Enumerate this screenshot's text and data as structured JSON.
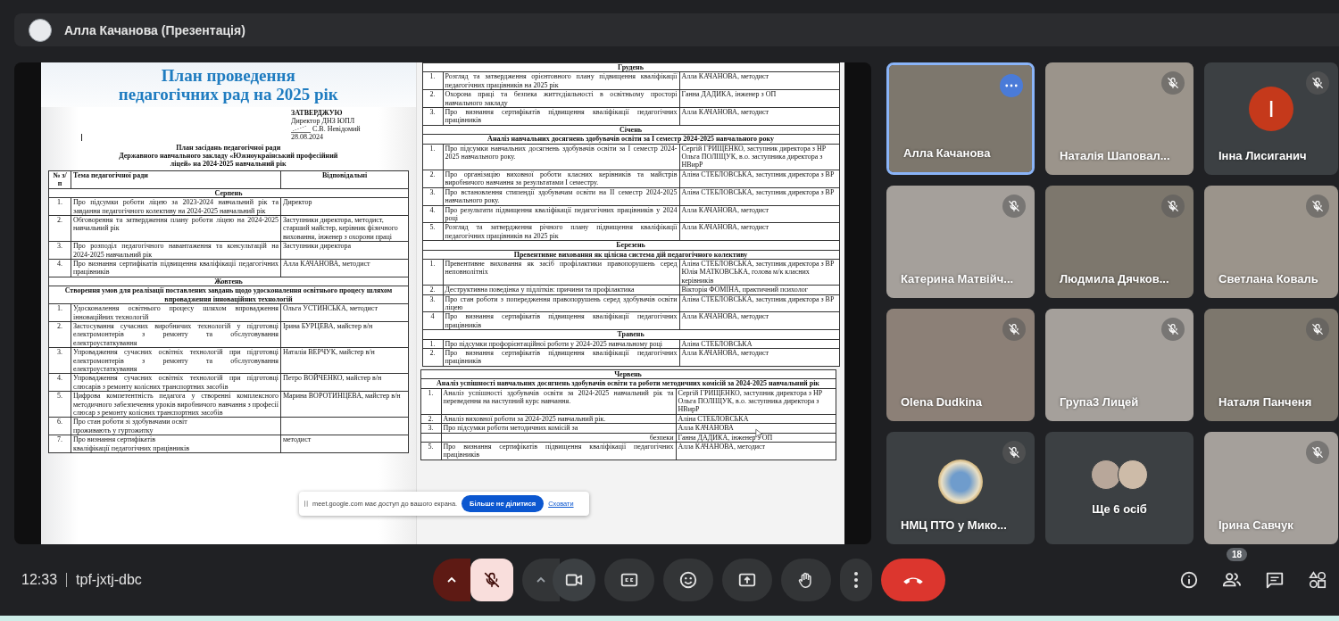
{
  "top_bar": {
    "title": "Алла Качанова (Презентація)"
  },
  "document": {
    "title_lines": [
      "План проведення",
      "педагогічних рад на 2025 рік"
    ],
    "approval": [
      {
        "text": "ЗАТВЕРДЖУЮ",
        "bold": true,
        "signed": false
      },
      {
        "text": "Директор ДНЗ ЮПЛ",
        "bold": false,
        "signed": false
      },
      {
        "text": "С.В. Невідомий",
        "bold": false,
        "signed": true
      },
      {
        "text": "28.08.2024",
        "bold": false,
        "signed": false
      }
    ],
    "heading_lines": [
      "План засідань педагогічної ради",
      "Державного навчального закладу «Южноукраїнський професійний",
      "ліцей» на 2024-2025 навчальний рік"
    ],
    "header": {
      "number": "№ з/п",
      "topic": "Тема педагогічної ради",
      "responsible": "Відповідальні"
    },
    "tables": [
      {
        "sections": [
          {
            "month": "Серпень",
            "rows": [
              {
                "number": "1.",
                "topic": "Про підсумки роботи ліцею за 2023-2024 навчальний рік та завдання педагогічного колективу на 2024-2025 навчальний рік",
                "responsible": "Директор"
              },
              {
                "number": "2.",
                "topic": "Обговорення та затвердження плану роботи ліцею на 2024-2025 навчальний рік",
                "responsible": "Заступники директора, методист, старший майстер, керівник фізичного виховання, інженер з охорони праці"
              },
              {
                "number": "3.",
                "topic": "Про розподіл педагогічного навантаження та консультацій на 2024-2025 навчальний рік",
                "responsible": "Заступники директора"
              },
              {
                "number": "4.",
                "topic": "Про визнання сертифікатів підвищення кваліфікації педагогічних працівників",
                "responsible": "Алла КАЧАНОВА, методист"
              }
            ]
          },
          {
            "month": "Жовтень",
            "theme": "Створення умов для реалізації поставлених завдань щодо удосконалення освітнього процесу шляхом впровадження інноваційних технологій",
            "rows": [
              {
                "number": "1.",
                "topic": "Удосконалення освітнього процесу шляхом впровадження інноваційних технологій",
                "responsible": "Ольга УСТИНСЬКА, методист"
              },
              {
                "number": "2.",
                "topic": "Застосування сучасних виробничих технологій у підготовці електромонтерів з ремонту та обслуговування електроустаткування",
                "responsible": "Ірина БУРЦЕВА, майстер в/н"
              },
              {
                "number": "3.",
                "topic": "Упровадження сучасних освітніх технологій при підготовці електромонтерів з ремонту та обслуговування електроустаткування",
                "responsible": "Наталія ВЕРЧУК, майстер в/н"
              },
              {
                "number": "4.",
                "topic": "Упровадження сучасних освітніх технологій при підготовці слюсарів з ремонту колісних транспортних засобів",
                "responsible": "Петро ВОЙЧЕНКО, майстер в/н"
              },
              {
                "number": "5.",
                "topic": "Цифрова компетентність педагога у створенні комплексного методичного забезпечення уроків виробничого навчання з професії слюсар з ремонту колісних транспортних засобів",
                "responsible": "Марина ВОРОТИНЦЕВА, майстер в/н"
              },
              {
                "number": "6.",
                "topic": "Про стан роботи зі здобувачами освіт\nпроживають у гуртожитку"
              },
              {
                "number": "7.",
                "topic": "Про визнання сертифікатів\nкваліфікації педагогічних працівників",
                "responsible": "методист"
              }
            ]
          }
        ]
      },
      {
        "sections": [
          {
            "month": "Грудень",
            "rows": [
              {
                "number": "1.",
                "topic": "Розгляд та затвердження орієнтовного плану підвищення кваліфікації педагогічних працівників на 2025 рік",
                "responsible": "Алла КАЧАНОВА, методист"
              },
              {
                "number": "2.",
                "topic": "Охорона праці та безпека життєдіяльності в освітньому просторі навчального закладу",
                "responsible": "Ганна ДАДИКА, інженер з ОП"
              },
              {
                "number": "3.",
                "topic": "Про визнання сертифікатів підвищення кваліфікації педагогічних працівників",
                "responsible": "Алла КАЧАНОВА, методист"
              }
            ]
          },
          {
            "month": "Січень",
            "theme": "Аналіз навчальних досягнень здобувачів освіти за I семестр 2024-2025 навчального року",
            "rows": [
              {
                "number": "1.",
                "topic": "Про підсумки навчальних досягнень здобувачів освіти за I семестр 2024-2025 навчального року.",
                "responsible": "Сергій ГРИЩЕНКО, заступник директора з НР Ольга ПОЛІЩУК, в.о. заступника директора з НВирР"
              },
              {
                "number": "2.",
                "topic": "Про організацію виховної роботи класних керівників та майстрів виробничого навчання за результатами I семестру.",
                "responsible": "Аліна СТЕБЛОВСЬКА, заступник директора з ВР"
              },
              {
                "number": "3.",
                "topic": "Про встановлення стипендії здобувачам освіти на II семестр 2024-2025 навчального року.",
                "responsible": "Аліна СТЕБЛОВСЬКА, заступник директора з ВР"
              },
              {
                "number": "4.",
                "topic": "Про результати підвищення кваліфікації педагогічних працівників у 2024 році",
                "responsible": "Алла КАЧАНОВА, методист"
              },
              {
                "number": "5.",
                "topic": "Розгляд та затвердження річного плану підвищення кваліфікації педагогічних працівників на 2025 рік",
                "responsible": "Алла КАЧАНОВА, методист"
              }
            ]
          },
          {
            "month": "Березень",
            "theme": "Превентивне виховання як цілісна система дій педагогічного колективу",
            "rows": [
              {
                "number": "1.",
                "topic": "Превентивне виховання як засіб профілактики правопорушень серед неповнолітніх",
                "responsible": "Аліна СТЕБЛОВСЬКА, заступник директора з ВР Юлія МАТКОВСЬКА, голова м/к класних керівників"
              },
              {
                "number": "2.",
                "topic": "Деструктивна поведінка у підлітків: причини та профілактика",
                "responsible": "Вікторія ФОМІНА, практичний психолог"
              },
              {
                "number": "3.",
                "topic": "Про стан роботи з попередження правопорушень серед здобувачів освіти ліцею",
                "responsible": "Аліна СТЕБЛОВСЬКА, заступник директора з ВР"
              },
              {
                "number": "4",
                "topic": "Про визнання сертифікатів підвищення кваліфікації педагогічних працівників",
                "responsible": "Алла КАЧАНОВА, методист"
              }
            ]
          },
          {
            "month": "Травень",
            "rows": [
              {
                "number": "1.",
                "topic": "Про підсумки профорієнтаційної роботи у 2024-2025 навчальному році",
                "responsible": "Аліна СТЕБЛОВСЬКА"
              },
              {
                "number": "2.",
                "topic": "Про визнання сертифікатів підвищення кваліфікації педагогічних працівників",
                "responsible": "Алла КАЧАНОВА, методист"
              }
            ]
          }
        ]
      },
      {
        "sections": [
          {
            "month": "Червень",
            "theme": "Аналіз успішності навчальних досягнень здобувачів освіти та роботи методичних комісій за 2024-2025 навчальний рік",
            "rows": [
              {
                "number": "1.",
                "topic": "Аналіз успішності здобувачів освіти за 2024-2025 навчальний рік та переведення на наступний курс навчання.",
                "responsible": "Сергій ГРИЩЕНКО, заступник директора з НР Ольга ПОЛІЩУК, в.о. заступника директора з НВирР"
              },
              {
                "number": "2.",
                "topic": "Аналіз виховної роботи за 2024-2025 навчальний рік.",
                "responsible": "Аліна СТЕБЛОВСЬКА"
              },
              {
                "number": "3.",
                "topic": "Про підсумки роботи методичних комісій за",
                "responsible": "Алла КАЧАНОВА"
              },
              {
                "topic": "безпеки",
                "responsible": "Ганна ДАДИКА, інженер з ОП"
              },
              {
                "number": "5.",
                "topic": "Про визнання сертифікатів підвищення кваліфікації педагогічних працівників",
                "responsible": "Алла КАЧАНОВА, методист"
              }
            ]
          }
        ]
      }
    ]
  },
  "share_banner": {
    "message": "meet.google.com має доступ до вашого екрана.",
    "stop_button": "Більше не ділитися",
    "hide_link": "Сховати"
  },
  "tiles": [
    {
      "name": "Алла Качанова",
      "kind": "video",
      "muted": false,
      "speaking": true
    },
    {
      "name": "Наталія Шаповал...",
      "kind": "video",
      "muted": true,
      "speaking": false
    },
    {
      "name": "Інна Лисиганич",
      "kind": "letter",
      "letter": "І",
      "color": "#c5391b",
      "muted": true,
      "speaking": false
    },
    {
      "name": "Катерина Матвійч...",
      "kind": "video",
      "muted": true,
      "speaking": false
    },
    {
      "name": "Людмила Дячков...",
      "kind": "video",
      "muted": true,
      "speaking": false
    },
    {
      "name": "Светлана Коваль",
      "kind": "video",
      "muted": true,
      "speaking": false
    },
    {
      "name": "Olena Dudkina",
      "kind": "video",
      "muted": true,
      "speaking": false
    },
    {
      "name": "Група3 Лицей",
      "kind": "video",
      "muted": true,
      "speaking": false
    },
    {
      "name": "Наталя Панченя",
      "kind": "video",
      "muted": true,
      "speaking": false
    },
    {
      "name": "НМЦ ПТО у Мико...",
      "kind": "logo",
      "muted": true,
      "speaking": false
    },
    {
      "name": "Ще 6 осіб",
      "kind": "group",
      "muted": false,
      "speaking": false
    },
    {
      "name": "Ірина Савчук",
      "kind": "video",
      "muted": true,
      "speaking": false
    }
  ],
  "bottom_bar": {
    "time": "12:33",
    "meeting_code": "tpf-jxtj-dbc",
    "controls": [
      {
        "kind": "microphone",
        "muted": true
      },
      {
        "kind": "camera"
      },
      {
        "kind": "captions"
      },
      {
        "kind": "emoji"
      },
      {
        "kind": "present"
      },
      {
        "kind": "hand"
      },
      {
        "kind": "more"
      },
      {
        "kind": "end-call"
      }
    ],
    "people_count": "18"
  }
}
